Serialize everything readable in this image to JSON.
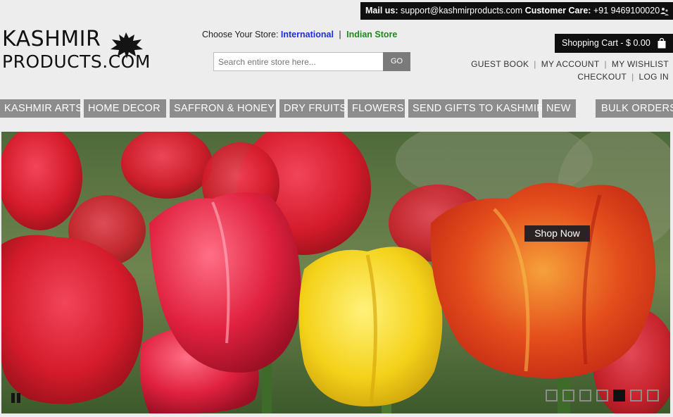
{
  "topbar": {
    "mail_label": "Mail us:",
    "mail_value": "support@kashmirproducts.com",
    "care_label": "Customer Care:",
    "care_value": "+91 9469100020",
    "icon": "contact-icon"
  },
  "logo": {
    "line1": "KASHMIR",
    "line2": "PRODUCTS.COM",
    "icon": "chinar-leaf-icon"
  },
  "store": {
    "label": "Choose Your Store:",
    "international": "International",
    "separator": "|",
    "india": "Indian Store"
  },
  "search": {
    "placeholder": "Search entire store here...",
    "button": "GO"
  },
  "cart": {
    "label": "Shopping Cart - $ 0.00",
    "icon": "shopping-bag-icon"
  },
  "account_links": {
    "row1": [
      "GUEST BOOK",
      "MY ACCOUNT",
      "MY WISHLIST"
    ],
    "row2": [
      "CHECKOUT",
      "LOG IN"
    ]
  },
  "nav": [
    "KASHMIR ARTS",
    "HOME DECOR",
    "SAFFRON & HONEY",
    "DRY FRUITS",
    "FLOWERS",
    "SEND GIFTS TO KASHMIR",
    "NEW",
    "BULK ORDERS"
  ],
  "banner": {
    "cta": "Shop Now",
    "pause_icon": "pause-icon",
    "slide_count": 7,
    "active_slide": 5
  },
  "colors": {
    "black_bar": "#0f0f0f",
    "nav_gray": "#8c8c8c",
    "international": "#1a2fd6",
    "india": "#1c8a1c"
  }
}
